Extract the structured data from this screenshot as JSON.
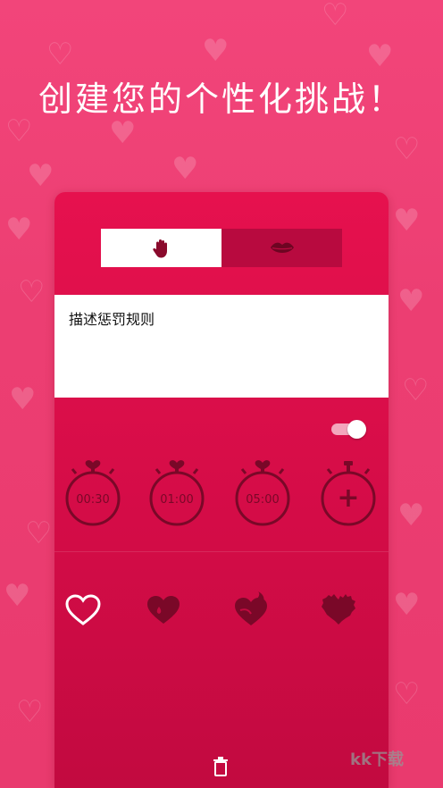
{
  "headline": "创建您的个性化挑战！",
  "mode_tabs": [
    {
      "name": "hand-icon",
      "selected": true
    },
    {
      "name": "lips-icon",
      "selected": false
    }
  ],
  "description": {
    "placeholder": "描述惩罚规则"
  },
  "toggle": {
    "on": true
  },
  "timers": [
    {
      "label": "00:30"
    },
    {
      "label": "01:00"
    },
    {
      "label": "05:00"
    },
    {
      "label": "+"
    }
  ],
  "intensity_icons": [
    "heart-outline-icon",
    "heart-drop-icon",
    "heart-flame-icon",
    "heart-spiky-icon"
  ],
  "colors": {
    "background": "#ee4078",
    "card": "#d80c48",
    "accent_dark": "#7a0828",
    "white": "#ffffff"
  },
  "footer": {
    "delete_icon": "trash-icon"
  },
  "watermark": "kk下载"
}
